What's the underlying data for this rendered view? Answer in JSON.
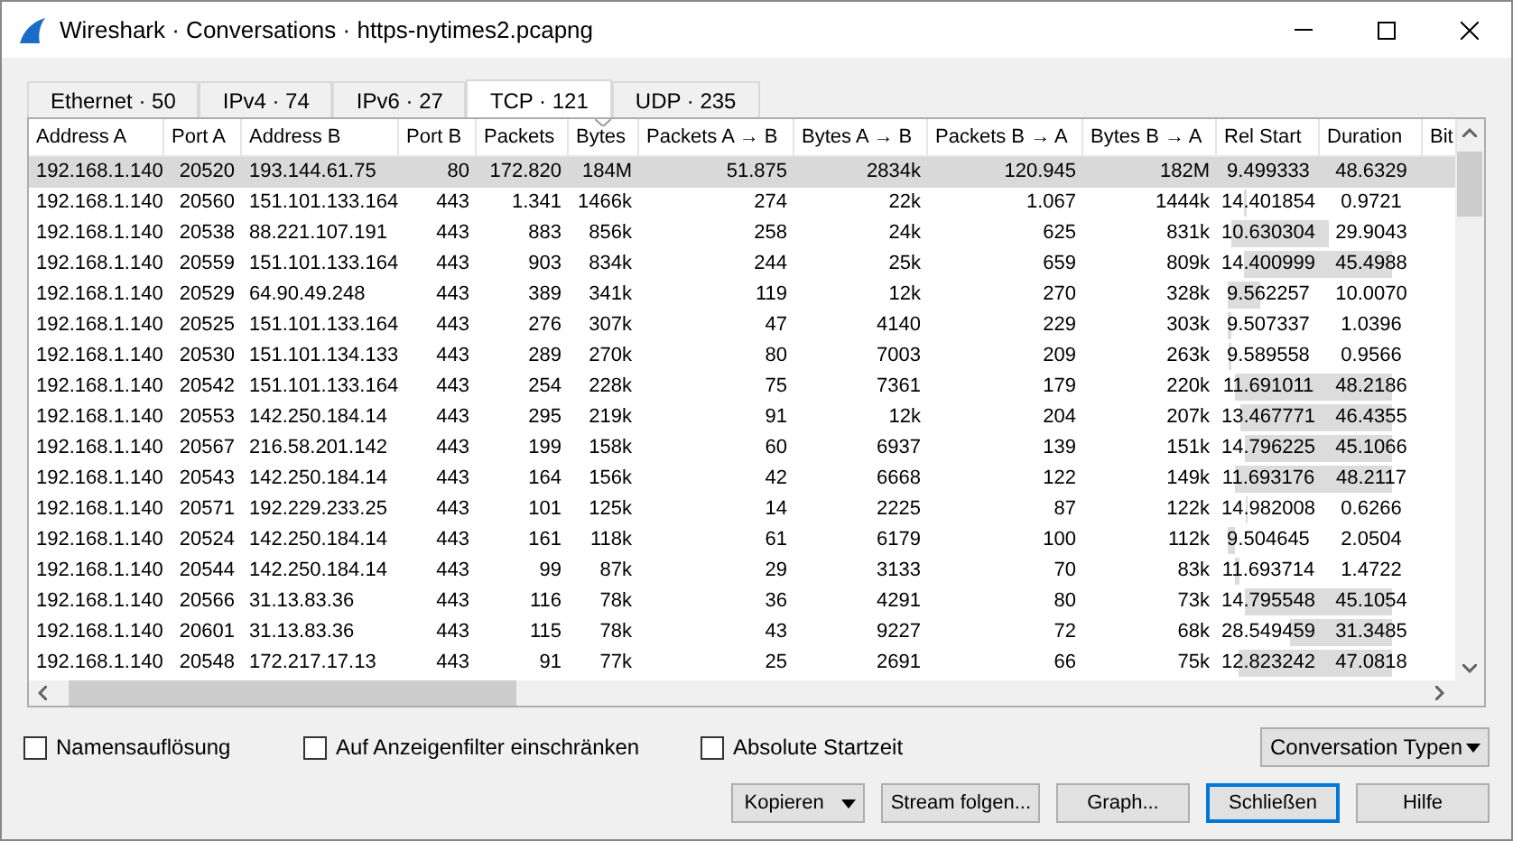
{
  "window": {
    "title": "Wireshark · Conversations · https-nytimes2.pcapng"
  },
  "tabs": [
    {
      "label": "Ethernet · 50",
      "selected": false
    },
    {
      "label": "IPv4 · 74",
      "selected": false
    },
    {
      "label": "IPv6 · 27",
      "selected": false
    },
    {
      "label": "TCP · 121",
      "selected": true
    },
    {
      "label": "UDP · 235",
      "selected": false
    }
  ],
  "table": {
    "columns": [
      {
        "label": "Address A",
        "sorted": false
      },
      {
        "label": "Port A",
        "sorted": false
      },
      {
        "label": "Address B",
        "sorted": false
      },
      {
        "label": "Port B",
        "sorted": false
      },
      {
        "label": "Packets",
        "sorted": false
      },
      {
        "label": "Bytes",
        "sorted": true
      },
      {
        "label": "Packets A → B",
        "sorted": false
      },
      {
        "label": "Bytes A → B",
        "sorted": false
      },
      {
        "label": "Packets B → A",
        "sorted": false
      },
      {
        "label": "Bytes B → A",
        "sorted": false
      },
      {
        "label": "Rel Start",
        "sorted": false
      },
      {
        "label": "Duration",
        "sorted": false
      },
      {
        "label": "Bit",
        "sorted": false
      }
    ],
    "rows": [
      {
        "selected": true,
        "cells": [
          "192.168.1.140",
          "20520",
          "193.144.61.75",
          "80",
          "172.820",
          "184M",
          "51.875",
          "2834k",
          "120.945",
          "182M",
          "9.499333",
          "48.6329"
        ]
      },
      {
        "selected": false,
        "cells": [
          "192.168.1.140",
          "20560",
          "151.101.133.164",
          "443",
          "1.341",
          "1466k",
          "274",
          "22k",
          "1.067",
          "1444k",
          "14.401854",
          "0.9721"
        ]
      },
      {
        "selected": false,
        "cells": [
          "192.168.1.140",
          "20538",
          "88.221.107.191",
          "443",
          "883",
          "856k",
          "258",
          "24k",
          "625",
          "831k",
          "10.630304",
          "29.9043"
        ]
      },
      {
        "selected": false,
        "cells": [
          "192.168.1.140",
          "20559",
          "151.101.133.164",
          "443",
          "903",
          "834k",
          "244",
          "25k",
          "659",
          "809k",
          "14.400999",
          "45.4988"
        ]
      },
      {
        "selected": false,
        "cells": [
          "192.168.1.140",
          "20529",
          "64.90.49.248",
          "443",
          "389",
          "341k",
          "119",
          "12k",
          "270",
          "328k",
          "9.562257",
          "10.0070"
        ]
      },
      {
        "selected": false,
        "cells": [
          "192.168.1.140",
          "20525",
          "151.101.133.164",
          "443",
          "276",
          "307k",
          "47",
          "4140",
          "229",
          "303k",
          "9.507337",
          "1.0396"
        ]
      },
      {
        "selected": false,
        "cells": [
          "192.168.1.140",
          "20530",
          "151.101.134.133",
          "443",
          "289",
          "270k",
          "80",
          "7003",
          "209",
          "263k",
          "9.589558",
          "0.9566"
        ]
      },
      {
        "selected": false,
        "cells": [
          "192.168.1.140",
          "20542",
          "151.101.133.164",
          "443",
          "254",
          "228k",
          "75",
          "7361",
          "179",
          "220k",
          "11.691011",
          "48.2186"
        ]
      },
      {
        "selected": false,
        "cells": [
          "192.168.1.140",
          "20553",
          "142.250.184.14",
          "443",
          "295",
          "219k",
          "91",
          "12k",
          "204",
          "207k",
          "13.467771",
          "46.4355"
        ]
      },
      {
        "selected": false,
        "cells": [
          "192.168.1.140",
          "20567",
          "216.58.201.142",
          "443",
          "199",
          "158k",
          "60",
          "6937",
          "139",
          "151k",
          "14.796225",
          "45.1066"
        ]
      },
      {
        "selected": false,
        "cells": [
          "192.168.1.140",
          "20543",
          "142.250.184.14",
          "443",
          "164",
          "156k",
          "42",
          "6668",
          "122",
          "149k",
          "11.693176",
          "48.2117"
        ]
      },
      {
        "selected": false,
        "cells": [
          "192.168.1.140",
          "20571",
          "192.229.233.25",
          "443",
          "101",
          "125k",
          "14",
          "2225",
          "87",
          "122k",
          "14.982008",
          "0.6266"
        ]
      },
      {
        "selected": false,
        "cells": [
          "192.168.1.140",
          "20524",
          "142.250.184.14",
          "443",
          "161",
          "118k",
          "61",
          "6179",
          "100",
          "112k",
          "9.504645",
          "2.0504"
        ]
      },
      {
        "selected": false,
        "cells": [
          "192.168.1.140",
          "20544",
          "142.250.184.14",
          "443",
          "99",
          "87k",
          "29",
          "3133",
          "70",
          "83k",
          "11.693714",
          "1.4722"
        ]
      },
      {
        "selected": false,
        "cells": [
          "192.168.1.140",
          "20566",
          "31.13.83.36",
          "443",
          "116",
          "78k",
          "36",
          "4291",
          "80",
          "73k",
          "14.795548",
          "45.1054"
        ]
      },
      {
        "selected": false,
        "cells": [
          "192.168.1.140",
          "20601",
          "31.13.83.36",
          "443",
          "115",
          "78k",
          "43",
          "9227",
          "72",
          "68k",
          "28.549459",
          "31.3485"
        ]
      },
      {
        "selected": false,
        "cells": [
          "192.168.1.140",
          "20548",
          "172.217.17.13",
          "443",
          "91",
          "77k",
          "25",
          "2691",
          "66",
          "75k",
          "12.823242",
          "47.0818"
        ]
      }
    ]
  },
  "options": [
    {
      "label": "Namensauflösung",
      "checked": false
    },
    {
      "label": "Auf Anzeigenfilter einschränken",
      "checked": false
    },
    {
      "label": "Absolute Startzeit",
      "checked": false
    }
  ],
  "conversation_types": {
    "label": "Conversation Typen"
  },
  "buttons": [
    {
      "label": "Kopieren",
      "kind": "menu",
      "default": false
    },
    {
      "label": "Stream folgen...",
      "kind": "plain",
      "default": false
    },
    {
      "label": "Graph...",
      "kind": "plain",
      "default": false
    },
    {
      "label": "Schließen",
      "kind": "plain",
      "default": true
    },
    {
      "label": "Hilfe",
      "kind": "plain",
      "default": false
    }
  ]
}
